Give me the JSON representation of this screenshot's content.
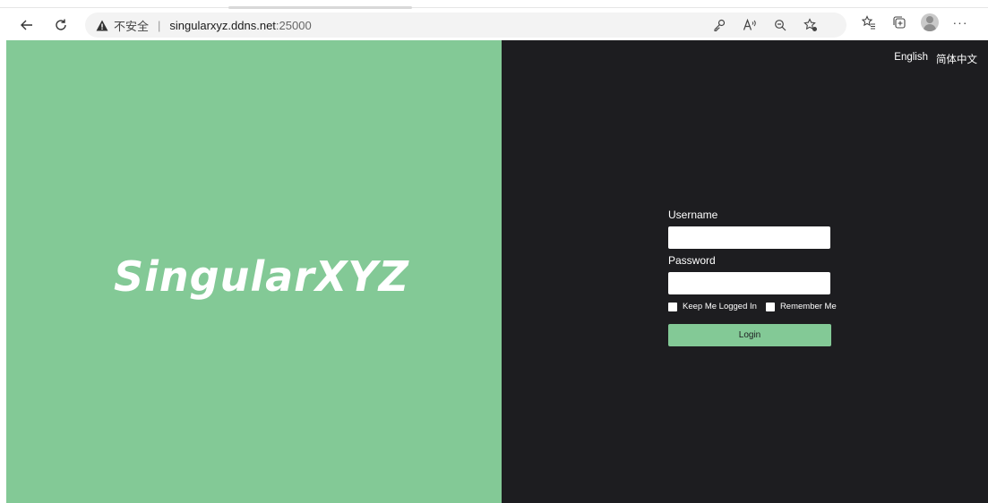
{
  "browser": {
    "address": {
      "insecure_label": "不安全",
      "separator": "|",
      "host": "singularxyz.ddns.net",
      "port": ":25000"
    },
    "more_label": "···"
  },
  "page": {
    "brand": "SingularXYZ",
    "colors": {
      "accent": "#83c996",
      "dark_bg": "#1d1d20"
    },
    "languages": [
      "English",
      "简体中文"
    ],
    "form": {
      "username_label": "Username",
      "username_value": "",
      "password_label": "Password",
      "password_value": "",
      "keep_logged_in_label": "Keep Me Logged In",
      "remember_me_label": "Remember Me",
      "login_label": "Login"
    }
  }
}
